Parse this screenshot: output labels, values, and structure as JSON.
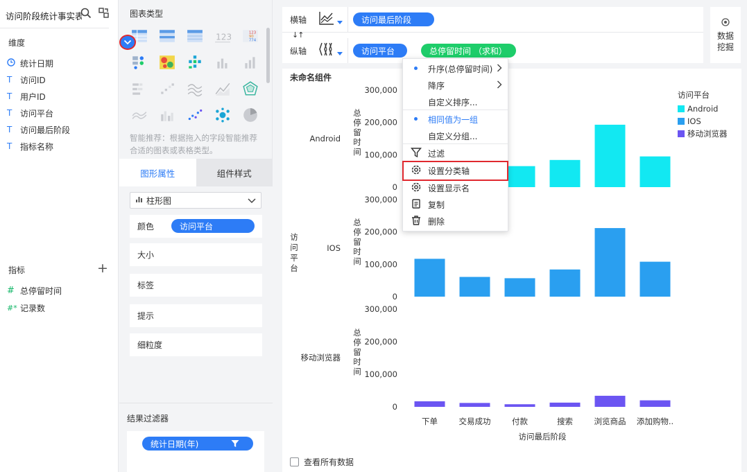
{
  "left_panel": {
    "title": "访问阶段统计事实表",
    "dimensions_heading": "维度",
    "dimensions": [
      {
        "kind": "date",
        "icon": "clock-icon",
        "label": "统计日期"
      },
      {
        "kind": "text",
        "icon": "T",
        "label": "访问ID"
      },
      {
        "kind": "text",
        "icon": "T",
        "label": "用户ID"
      },
      {
        "kind": "text",
        "icon": "T",
        "label": "访问平台"
      },
      {
        "kind": "text",
        "icon": "T",
        "label": "访问最后阶段"
      },
      {
        "kind": "text",
        "icon": "T",
        "label": "指标名称"
      }
    ],
    "metrics_heading": "指标",
    "metrics": [
      {
        "icon": "#",
        "label": "总停留时间"
      },
      {
        "icon": "#*",
        "label": "记录数"
      }
    ]
  },
  "middle_panel": {
    "chart_types_title": "图表类型",
    "recommend_hint": "智能推荐：根据拖入的字段智能推荐合适的图表或表格类型。",
    "tabs": [
      {
        "label": "图形属性",
        "active": true
      },
      {
        "label": "组件样式",
        "active": false
      }
    ],
    "chart_kind_select": "柱形图",
    "properties": [
      {
        "label": "颜色",
        "pill": "访问平台"
      },
      {
        "label": "大小"
      },
      {
        "label": "标签"
      },
      {
        "label": "提示"
      },
      {
        "label": "细粒度"
      }
    ],
    "result_filter_title": "结果过滤器",
    "result_filter_pill": "统计日期(年)"
  },
  "axes": {
    "x_label": "横轴",
    "y_label": "纵轴",
    "x_pill": "访问最后阶段",
    "y_pill": "访问平台",
    "y_measure_pill": "总停留时间 （求和）"
  },
  "mining_button": "数据挖掘",
  "component_name": "未命名组件",
  "context_menu": [
    {
      "label": "升序(总停留时间)",
      "selected": true,
      "submenu": true
    },
    {
      "label": "降序",
      "selected": false,
      "submenu": true
    },
    {
      "label": "自定义排序...",
      "selected": false,
      "submenu": false
    },
    {
      "label": "相同值为一组",
      "selected": true,
      "submenu": false
    },
    {
      "label": "自定义分组...",
      "selected": false,
      "submenu": false
    },
    {
      "label": "过滤",
      "icon": "filter-icon"
    },
    {
      "label": "设置分类轴",
      "icon": "gear-icon",
      "highlighted": true
    },
    {
      "label": "设置显示名",
      "icon": "gear-icon"
    },
    {
      "label": "复制",
      "icon": "copy-icon"
    },
    {
      "label": "删除",
      "icon": "trash-icon"
    }
  ],
  "view_all_data": "查看所有数据",
  "colors": {
    "android": "#12e8f2",
    "ios": "#2a9ff0",
    "mobile_browser": "#6b55f2",
    "accent": "#2d7cf6",
    "measure": "#1ecd6a"
  },
  "chart_data": {
    "type": "bar",
    "xlabel": "访问最后阶段",
    "ylabel": "总停留时间",
    "row_axis_label": "访问平台",
    "categories": [
      "下单",
      "交易成功",
      "付款",
      "搜索",
      "浏览商品",
      "添加购物.."
    ],
    "yticks": [
      "300,000",
      "200,000",
      "100,000",
      "0"
    ],
    "ylim": [
      0,
      300000
    ],
    "legend_title": "访问平台",
    "legend_position": "top-right",
    "series": [
      {
        "name": "Android",
        "color": "#12e8f2",
        "values": [
          null,
          null,
          65000,
          84000,
          193000,
          95000
        ]
      },
      {
        "name": "IOS",
        "color": "#2a9ff0",
        "values": [
          117000,
          61000,
          57000,
          84000,
          212000,
          108000
        ]
      },
      {
        "name": "移动浏览器",
        "color": "#6b55f2",
        "values": [
          17000,
          12000,
          8000,
          13000,
          34000,
          20000
        ]
      }
    ]
  }
}
